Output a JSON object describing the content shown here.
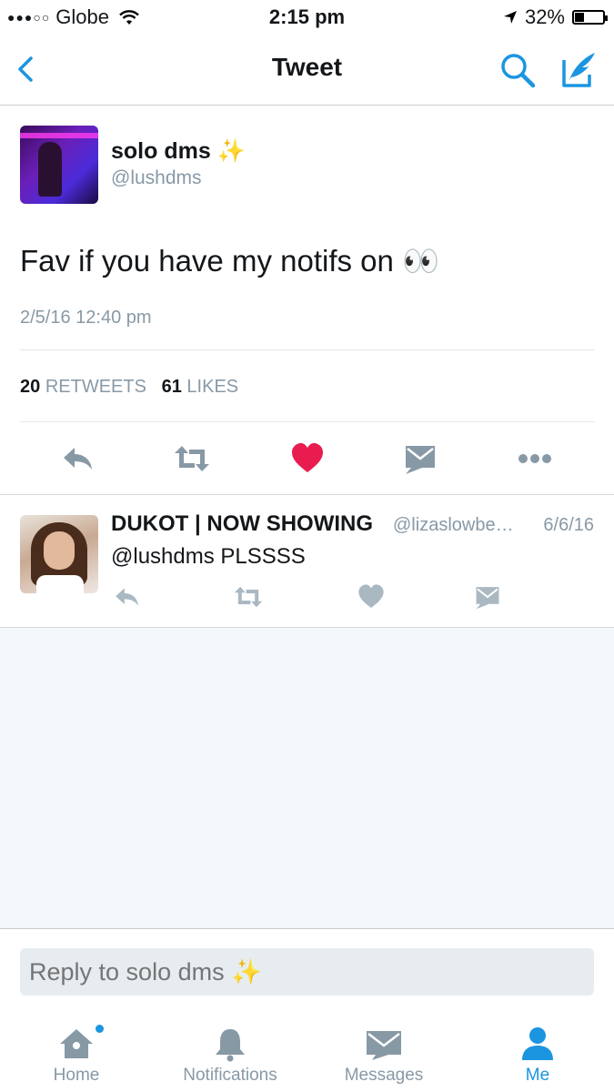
{
  "status_bar": {
    "signal": "●●●○○",
    "carrier": "Globe",
    "time": "2:15 pm",
    "battery": "32%",
    "battery_level": 0.32
  },
  "nav": {
    "title": "Tweet",
    "back_icon": "chevron-left-icon",
    "search_icon": "search-icon",
    "compose_icon": "compose-tweet-icon"
  },
  "tweet": {
    "display_name": "solo dms ✨",
    "handle": "@lushdms",
    "text": "Fav if you have my notifs on 👀",
    "timestamp": "2/5/16 12:40 pm",
    "retweet_count": "20",
    "retweet_label": "RETWEETS",
    "like_count": "61",
    "like_label": "LIKES",
    "liked": true
  },
  "reply": {
    "display_name": "DUKOT | NOW SHOWING",
    "handle": "@lizaslowbe…",
    "date": "6/6/16",
    "text": "@lushdms PLSSSS"
  },
  "reply_box": {
    "placeholder": "Reply to solo dms ✨"
  },
  "tabs": [
    {
      "label": "Home",
      "icon": "home-icon",
      "has_notification_dot": true
    },
    {
      "label": "Notifications",
      "icon": "bell-icon"
    },
    {
      "label": "Messages",
      "icon": "envelope-icon"
    },
    {
      "label": "Me",
      "icon": "person-icon",
      "active": true
    }
  ],
  "colors": {
    "accent": "#1b95e0",
    "like_red": "#e81c4f",
    "secondary": "#8899a6",
    "icon_gray": "#aab8c2"
  }
}
